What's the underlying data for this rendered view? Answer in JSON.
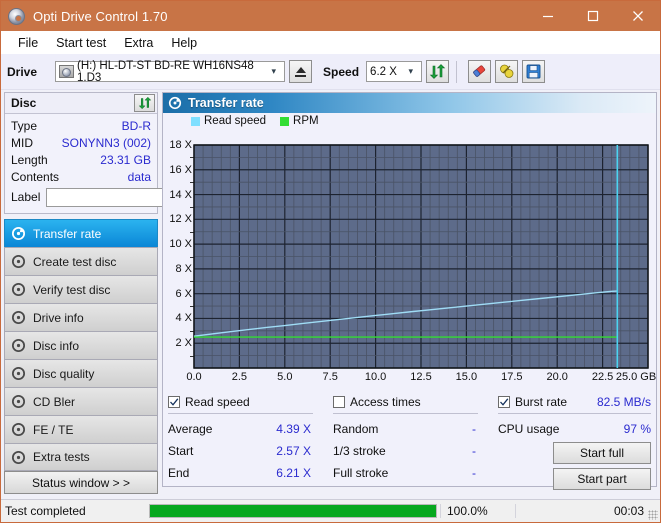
{
  "window": {
    "title": "Opti Drive Control 1.70",
    "icon": "disc-icon",
    "minimize": "minimize-icon",
    "maximize": "maximize-icon",
    "close": "close-icon"
  },
  "menu": {
    "items": [
      {
        "label": "File"
      },
      {
        "label": "Start test"
      },
      {
        "label": "Extra"
      },
      {
        "label": "Help"
      }
    ]
  },
  "toolbar": {
    "drive_label": "Drive",
    "drive_value": "(H:)  HL-DT-ST BD-RE  WH16NS48 1.D3",
    "eject_icon": "eject-icon",
    "speed_label": "Speed",
    "speed_value": "6.2 X",
    "refresh_icon": "refresh-icon",
    "erase_icon": "eraser-icon",
    "tools_icon": "bulb-icon",
    "save_icon": "floppy-save-icon"
  },
  "disc_panel": {
    "title": "Disc",
    "refresh_icon": "refresh-icon",
    "rows": [
      {
        "key": "Type",
        "value": "BD-R"
      },
      {
        "key": "MID",
        "value": "SONYNN3 (002)"
      },
      {
        "key": "Length",
        "value": "23.31 GB"
      },
      {
        "key": "Contents",
        "value": "data"
      }
    ],
    "label_key": "Label",
    "label_value": "",
    "label_placeholder": "",
    "label_button_icon": "cd-icon"
  },
  "sidebar": {
    "items": [
      {
        "label": "Transfer rate",
        "icon": "disc-icon",
        "active": true
      },
      {
        "label": "Create test disc",
        "icon": "disc-icon",
        "active": false
      },
      {
        "label": "Verify test disc",
        "icon": "disc-icon",
        "active": false
      },
      {
        "label": "Drive info",
        "icon": "disc-icon",
        "active": false
      },
      {
        "label": "Disc info",
        "icon": "disc-icon",
        "active": false
      },
      {
        "label": "Disc quality",
        "icon": "disc-icon",
        "active": false
      },
      {
        "label": "CD Bler",
        "icon": "disc-icon",
        "active": false
      },
      {
        "label": "FE / TE",
        "icon": "disc-icon",
        "active": false
      },
      {
        "label": "Extra tests",
        "icon": "disc-icon",
        "active": false
      }
    ],
    "status_window_button": "Status window > >"
  },
  "panel": {
    "title": "Transfer rate",
    "icon": "disc-icon"
  },
  "chart_data": {
    "type": "line",
    "title": "Transfer rate",
    "xlabel": "GB",
    "ylabel": "X",
    "xlim": [
      0.0,
      25.0
    ],
    "ylim": [
      0,
      18
    ],
    "grid": true,
    "legend_position": "top-left",
    "plot_bg": "#5d6b8a",
    "grid_color": "#3b4355",
    "x_ticks": [
      "0.0",
      "2.5",
      "5.0",
      "7.5",
      "10.0",
      "12.5",
      "15.0",
      "17.5",
      "20.0",
      "22.5",
      "25.0 GB"
    ],
    "x_tick_values": [
      0.0,
      2.5,
      5.0,
      7.5,
      10.0,
      12.5,
      15.0,
      17.5,
      20.0,
      22.5,
      25.0
    ],
    "y_ticks": [
      "2 X",
      "4 X",
      "6 X",
      "8 X",
      "10 X",
      "12 X",
      "14 X",
      "16 X",
      "18 X"
    ],
    "y_tick_values": [
      2,
      4,
      6,
      8,
      10,
      12,
      14,
      16,
      18
    ],
    "legend": [
      {
        "name": "Read speed",
        "color": "#7fdfff"
      },
      {
        "name": "RPM",
        "color": "#33dd33"
      }
    ],
    "series": [
      {
        "name": "Read speed",
        "color": "#9fdcf5",
        "x": [
          0.0,
          1.0,
          2.0,
          3.0,
          4.0,
          5.0,
          6.0,
          7.0,
          8.0,
          9.0,
          10.0,
          11.0,
          12.0,
          13.0,
          14.0,
          15.0,
          16.0,
          17.0,
          18.0,
          19.0,
          20.0,
          21.0,
          22.0,
          23.0,
          23.3
        ],
        "y": [
          2.57,
          2.75,
          2.93,
          3.1,
          3.27,
          3.43,
          3.6,
          3.76,
          3.92,
          4.08,
          4.24,
          4.39,
          4.55,
          4.7,
          4.85,
          5.0,
          5.15,
          5.3,
          5.45,
          5.6,
          5.75,
          5.9,
          6.05,
          6.19,
          6.21
        ]
      },
      {
        "name": "RPM",
        "color": "#33dd33",
        "x": [
          0.0,
          5.0,
          10.0,
          15.0,
          20.0,
          23.3
        ],
        "y": [
          2.5,
          2.5,
          2.5,
          2.5,
          2.5,
          2.5
        ]
      }
    ],
    "marker_line": {
      "x": 23.31,
      "color": "#4cd3f0"
    },
    "end_of_data_gb": 23.31
  },
  "stats": {
    "read_speed": {
      "checkbox_label": "Read speed",
      "checked": true,
      "rows": [
        {
          "key": "Average",
          "value": "4.39 X"
        },
        {
          "key": "Start",
          "value": "2.57 X"
        },
        {
          "key": "End",
          "value": "6.21 X"
        }
      ]
    },
    "access_times": {
      "checkbox_label": "Access times",
      "checked": false,
      "rows": [
        {
          "key": "Random",
          "value": "-"
        },
        {
          "key": "1/3 stroke",
          "value": "-"
        },
        {
          "key": "Full stroke",
          "value": "-"
        }
      ]
    },
    "burst": {
      "checkbox_label": "Burst rate",
      "checked": true,
      "value": "82.5 MB/s",
      "cpu_key": "CPU usage",
      "cpu_value": "97 %",
      "start_full_button": "Start full",
      "start_part_button": "Start part"
    }
  },
  "statusbar": {
    "message": "Test completed",
    "progress_percent": 100.0,
    "progress_text": "100.0%",
    "elapsed": "00:03"
  },
  "colors": {
    "titlebar": "#c87446",
    "accent_blue": "#2b2bcf",
    "progress_green": "#06a81e",
    "active_nav": "#0a86d6"
  }
}
